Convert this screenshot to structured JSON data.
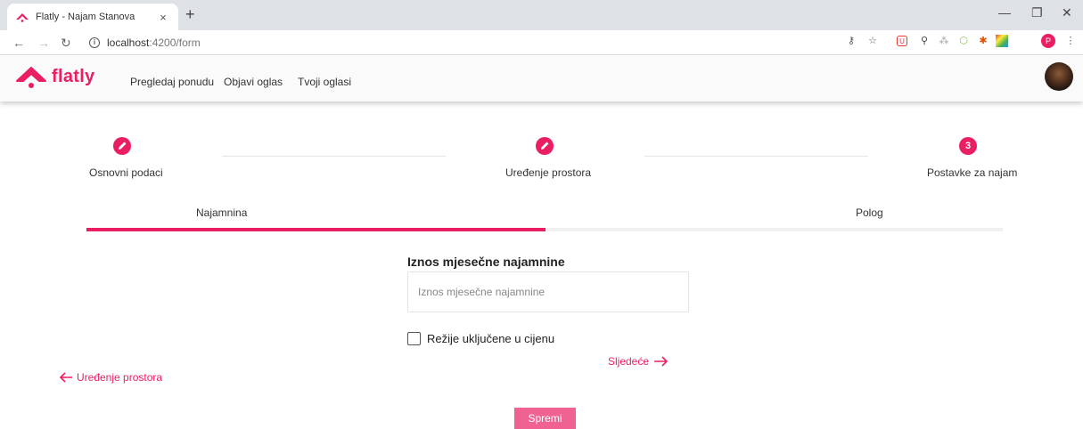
{
  "browser": {
    "tab_title": "Flatly - Najam Stanova",
    "url_host": "localhost",
    "url_path": ":4200/form",
    "profile_initial": "P"
  },
  "app": {
    "brand": "flatly",
    "brand_color": "#e91e63",
    "nav": [
      "Pregledaj ponudu",
      "Objavi oglas",
      "Tvoji oglasi"
    ]
  },
  "stepper": {
    "steps": [
      {
        "label": "Osnovni podaci",
        "icon": "pencil-icon",
        "state": "done"
      },
      {
        "label": "Uređenje prostora",
        "icon": "pencil-icon",
        "state": "done"
      },
      {
        "label": "Postavke za najam",
        "number": "3",
        "state": "active"
      }
    ]
  },
  "tabs": {
    "items": [
      "Najamnina",
      "Polog"
    ],
    "active_index": 0
  },
  "form": {
    "field_label": "Iznos mjesečne najamnine",
    "field_placeholder": "Iznos mjesečne najamnine",
    "field_value": "",
    "checkbox_label": "Režije uključene u cijenu",
    "checkbox_checked": false
  },
  "actions": {
    "next_label": "Sljedeće",
    "back_label": "Uređenje prostora",
    "save_label": "Spremi"
  }
}
